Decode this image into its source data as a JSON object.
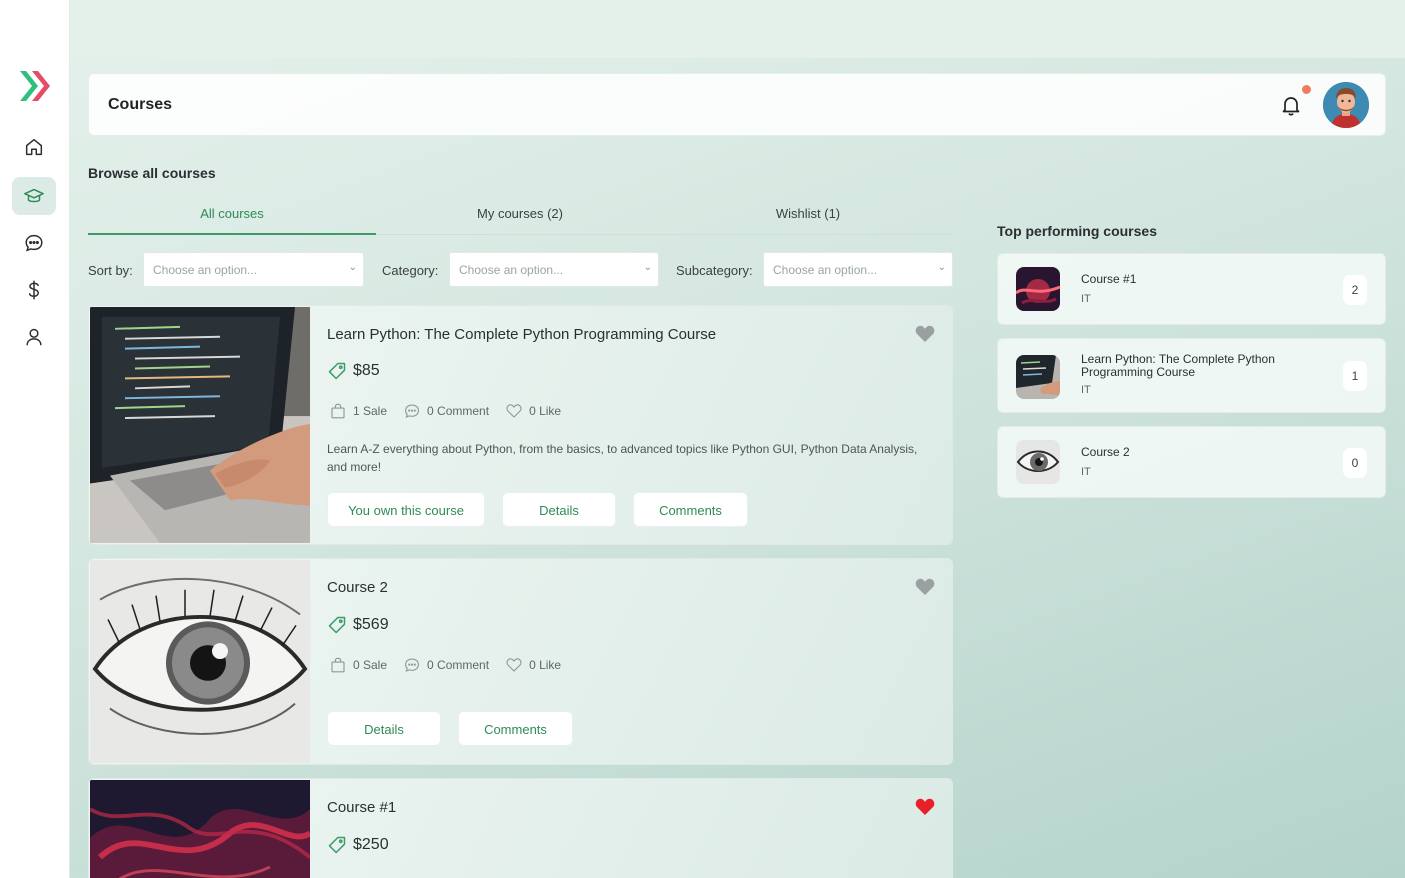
{
  "app": {
    "accent": "#3c9c69",
    "logo_colors": [
      "#2fbf7f",
      "#e23d5a"
    ]
  },
  "sidebar": {
    "items": [
      {
        "name": "home",
        "icon": "home-icon",
        "active": false
      },
      {
        "name": "courses",
        "icon": "graduation-cap-icon",
        "active": true
      },
      {
        "name": "messages",
        "icon": "chat-icon",
        "active": false
      },
      {
        "name": "payments",
        "icon": "dollar-icon",
        "active": false
      },
      {
        "name": "profile",
        "icon": "user-icon",
        "active": false
      }
    ]
  },
  "header": {
    "title": "Courses",
    "has_notification": true
  },
  "browse": {
    "title": "Browse all courses",
    "tabs": [
      {
        "label": "All courses",
        "active": true
      },
      {
        "label": "My courses (2)",
        "active": false
      },
      {
        "label": "Wishlist (1)",
        "active": false
      }
    ],
    "filters": {
      "sort_label": "Sort by:",
      "sort_placeholder": "Choose an option...",
      "category_label": "Category:",
      "category_placeholder": "Choose an option...",
      "subcategory_label": "Subcategory:",
      "subcategory_placeholder": "Choose an option..."
    }
  },
  "courses": [
    {
      "title": "Learn Python: The Complete Python Programming Course",
      "price": "$85",
      "sales": "1 Sale",
      "comments": "0 Comment",
      "likes": "0 Like",
      "description": "Learn A-Z everything about Python, from the basics, to advanced topics like Python GUI, Python Data Analysis, and more!",
      "wishlisted": false,
      "buttons": {
        "own": "You own this course",
        "details": "Details",
        "comments": "Comments"
      }
    },
    {
      "title": "Course 2",
      "price": "$569",
      "sales": "0 Sale",
      "comments": "0 Comment",
      "likes": "0 Like",
      "description": "",
      "wishlisted": false,
      "buttons": {
        "details": "Details",
        "comments": "Comments"
      }
    },
    {
      "title": "Course #1",
      "price": "$250",
      "wishlisted": true
    }
  ],
  "top_courses": {
    "title": "Top performing courses",
    "items": [
      {
        "name": "Course #1",
        "category": "IT",
        "count": "2"
      },
      {
        "name": "Learn Python: The Complete Python Programming Course",
        "category": "IT",
        "count": "1"
      },
      {
        "name": "Course 2",
        "category": "IT",
        "count": "0"
      }
    ]
  },
  "colors": {
    "heart_inactive": "#9a9fa2",
    "heart_active": "#e8202a",
    "notification_dot": "#f27a5e"
  }
}
